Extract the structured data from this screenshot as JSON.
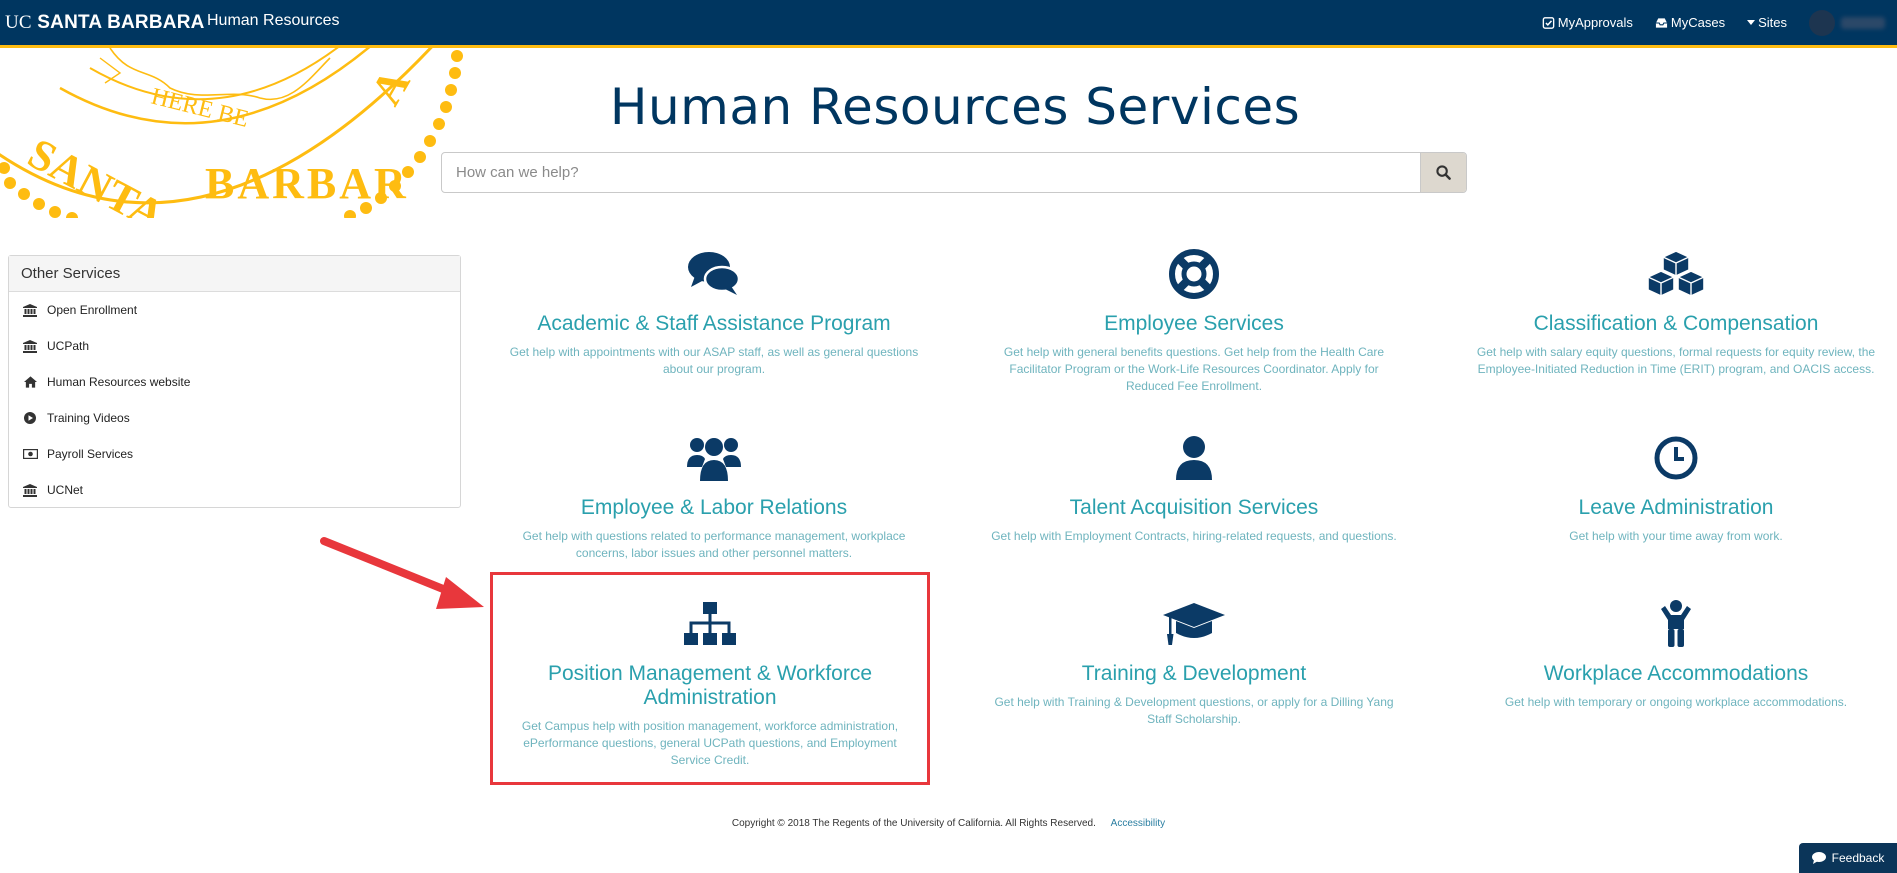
{
  "header": {
    "brand_uc": "UC",
    "brand_name": "SANTA BARBARA",
    "department": "Human Resources",
    "links": [
      {
        "label": "MyApprovals",
        "icon": "check-square-icon"
      },
      {
        "label": "MyCases",
        "icon": "inbox-icon"
      },
      {
        "label": "Sites",
        "icon": "caret-down-icon"
      }
    ]
  },
  "seal": {
    "text_top": "HERE BE",
    "text_bottom": "SANTA BARBARA",
    "color": "#febc11"
  },
  "hero": {
    "title": "Human Resources Services",
    "search_placeholder": "How can we help?"
  },
  "sidebar": {
    "title": "Other Services",
    "items": [
      {
        "label": "Open Enrollment",
        "icon": "institution-icon"
      },
      {
        "label": "UCPath",
        "icon": "institution-icon"
      },
      {
        "label": "Human Resources website",
        "icon": "home-icon"
      },
      {
        "label": "Training Videos",
        "icon": "play-circle-icon"
      },
      {
        "label": "Payroll Services",
        "icon": "money-icon"
      },
      {
        "label": "UCNet",
        "icon": "institution-icon"
      }
    ]
  },
  "services": [
    {
      "title": "Academic & Staff Assistance Program",
      "desc": "Get help with appointments with our ASAP staff, as well as general questions about our program.",
      "icon": "comments-icon"
    },
    {
      "title": "Employee Services",
      "desc": "Get help with general benefits questions. Get help from the Health Care Facilitator Program or the Work-Life Resources Coordinator. Apply for Reduced Fee Enrollment.",
      "icon": "life-ring-icon"
    },
    {
      "title": "Classification & Compensation",
      "desc": "Get help with salary equity questions, formal requests for equity review, the Employee-Initiated Reduction in Time (ERIT) program, and OACIS access.",
      "icon": "cubes-icon"
    },
    {
      "title": "Employee & Labor Relations",
      "desc": "Get help with questions related to performance management, workplace concerns, labor issues and other personnel matters.",
      "icon": "users-icon"
    },
    {
      "title": "Talent Acquisition Services",
      "desc": "Get help with Employment Contracts, hiring-related requests, and questions.",
      "icon": "user-icon"
    },
    {
      "title": "Leave Administration",
      "desc": "Get help with your time away from work.",
      "icon": "clock-icon"
    },
    {
      "title": "Position Management & Workforce Administration",
      "desc": "Get Campus help with position management, workforce administration, ePerformance questions, general UCPath questions, and Employment Service Credit.",
      "icon": "sitemap-icon"
    },
    {
      "title": "Training & Development",
      "desc": "Get help with Training & Development questions, or apply for a Dilling Yang Staff Scholarship.",
      "icon": "graduation-cap-icon"
    },
    {
      "title": "Workplace Accommodations",
      "desc": "Get help with temporary or ongoing workplace accommodations.",
      "icon": "child-icon"
    }
  ],
  "footer": {
    "copyright": "Copyright © 2018 The Regents of the University of California. All Rights Reserved.",
    "accessibility": "Accessibility"
  },
  "feedback_label": "Feedback",
  "colors": {
    "navy": "#003660",
    "gold": "#febc11",
    "teal_title": "#2aa0ad",
    "highlight_red": "#e8373c"
  }
}
